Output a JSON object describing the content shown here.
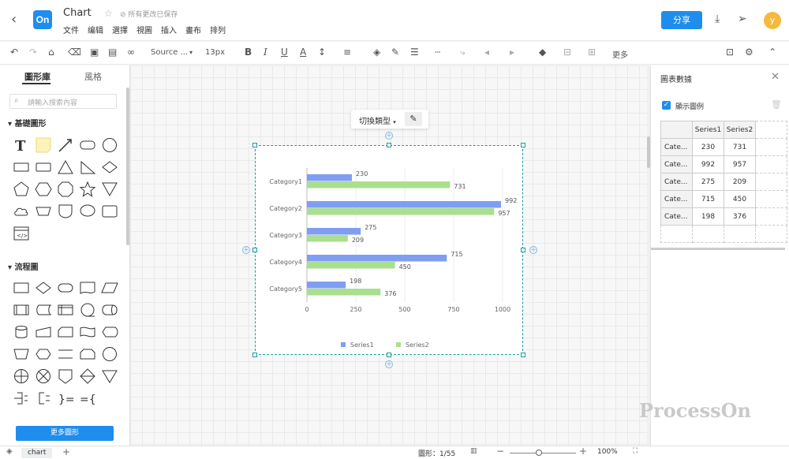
{
  "header": {
    "title": "Chart",
    "save_status": "所有更改已保存",
    "menus": [
      "文件",
      "编辑",
      "選擇",
      "視圖",
      "插入",
      "畫布",
      "排列"
    ],
    "share_label": "分享",
    "avatar_letter": "y"
  },
  "toolbar": {
    "font_name": "Source ...",
    "font_size": "13px",
    "more_label": "更多"
  },
  "sidebar": {
    "tabs": [
      "圖形庫",
      "風格"
    ],
    "search_placeholder": "請輸入搜索內容",
    "section_basic": "基礎圖形",
    "section_flow": "流程圖",
    "more_shapes": "更多圖形"
  },
  "canvas": {
    "switch_label": "切換類型"
  },
  "chart_data": {
    "type": "bar",
    "orientation": "horizontal",
    "categories": [
      "Category1",
      "Category2",
      "Category3",
      "Category4",
      "Category5"
    ],
    "series": [
      {
        "name": "Series1",
        "values": [
          230,
          992,
          275,
          715,
          198
        ],
        "color": "#7f9ef3"
      },
      {
        "name": "Series2",
        "values": [
          731,
          957,
          209,
          450,
          376
        ],
        "color": "#a9df8f"
      }
    ],
    "xticks": [
      "0",
      "250",
      "500",
      "750",
      "1000"
    ],
    "xlim": [
      0,
      1000
    ],
    "legend": "bottom-center",
    "grid": true
  },
  "rpanel": {
    "title": "圖表數據",
    "show_legend": "顯示圖例",
    "headers": [
      "Series1",
      "Series2"
    ],
    "rows": [
      {
        "cat": "Cate...",
        "v1": "230",
        "v2": "731"
      },
      {
        "cat": "Cate...",
        "v1": "992",
        "v2": "957"
      },
      {
        "cat": "Cate...",
        "v1": "275",
        "v2": "209"
      },
      {
        "cat": "Cate...",
        "v1": "715",
        "v2": "450"
      },
      {
        "cat": "Cate...",
        "v1": "198",
        "v2": "376"
      }
    ]
  },
  "status": {
    "sheet_name": "chart",
    "shape_count": "圖形：1/55",
    "zoom": "100%"
  },
  "watermark": "ProcessOn"
}
